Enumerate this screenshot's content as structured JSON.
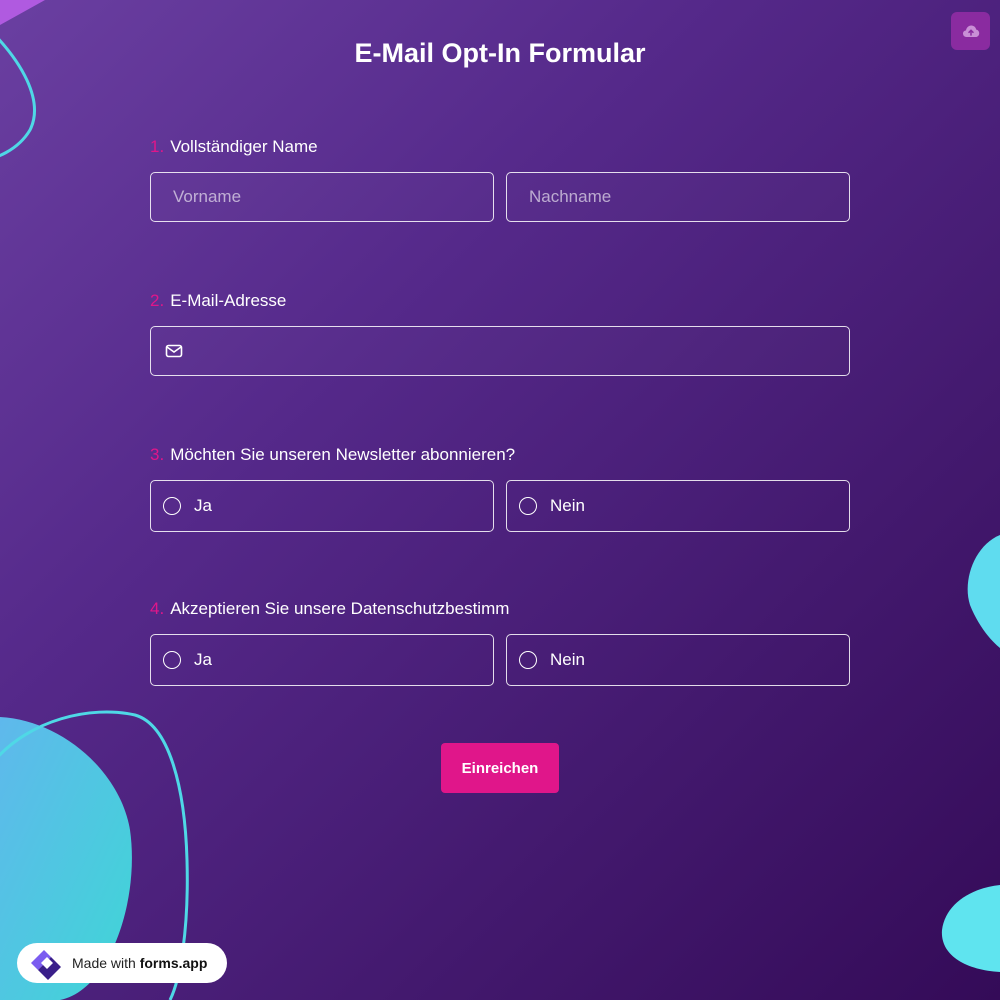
{
  "form": {
    "title": "E-Mail Opt-In Formular"
  },
  "questions": [
    {
      "number": "1.",
      "label": "Vollständiger Name",
      "first_name_placeholder": "Vorname",
      "last_name_placeholder": "Nachname"
    },
    {
      "number": "2.",
      "label": "E-Mail-Adresse",
      "email_value": "",
      "email_icon": "envelope-icon"
    },
    {
      "number": "3.",
      "label": "Möchten Sie unseren Newsletter abonnieren?",
      "options": [
        "Ja",
        "Nein"
      ]
    },
    {
      "number": "4.",
      "label": "Akzeptieren Sie unsere Datenschutzbestimm",
      "options": [
        "Ja",
        "Nein"
      ]
    }
  ],
  "submit_label": "Einreichen",
  "badge": {
    "prefix": "Made with ",
    "brand": "forms.app"
  },
  "colors": {
    "accent": "#e0168a",
    "background_start": "#6a3fa1",
    "background_end": "#340b58",
    "blob": "#4fd8e6"
  },
  "icons": {
    "upload": "cloud-upload-icon",
    "email": "envelope-icon",
    "logo": "forms-app-logo-icon"
  }
}
